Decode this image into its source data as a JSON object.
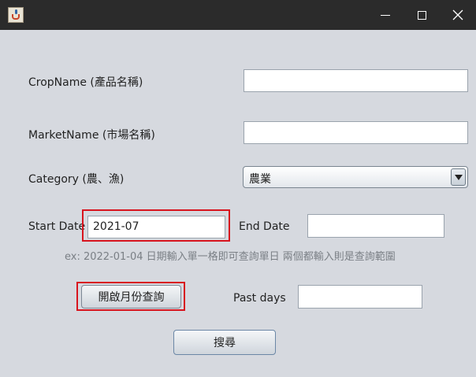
{
  "window": {
    "icon": "java-cup-icon",
    "controls": [
      "minimize-icon",
      "maximize-icon",
      "close-icon"
    ]
  },
  "form": {
    "crop_label": "CropName (產品名稱)",
    "crop_value": "",
    "market_label": "MarketName (市場名稱)",
    "market_value": "",
    "category_label": "Category (農、漁)",
    "category_value": "農業",
    "start_label": "Start Date",
    "start_value": "2021-07",
    "end_label": "End Date",
    "end_value": "",
    "hint": "ex:  2022-01-04 日期輸入單一格即可查詢單日 兩個都輸入則是查詢範圍",
    "month_button": "開啟月份查詢",
    "past_label": "Past days",
    "past_value": "",
    "search_button": "搜尋"
  },
  "colors": {
    "highlight": "#d8141e",
    "background": "#d6d9df",
    "titlebar": "#2b2b2b"
  }
}
